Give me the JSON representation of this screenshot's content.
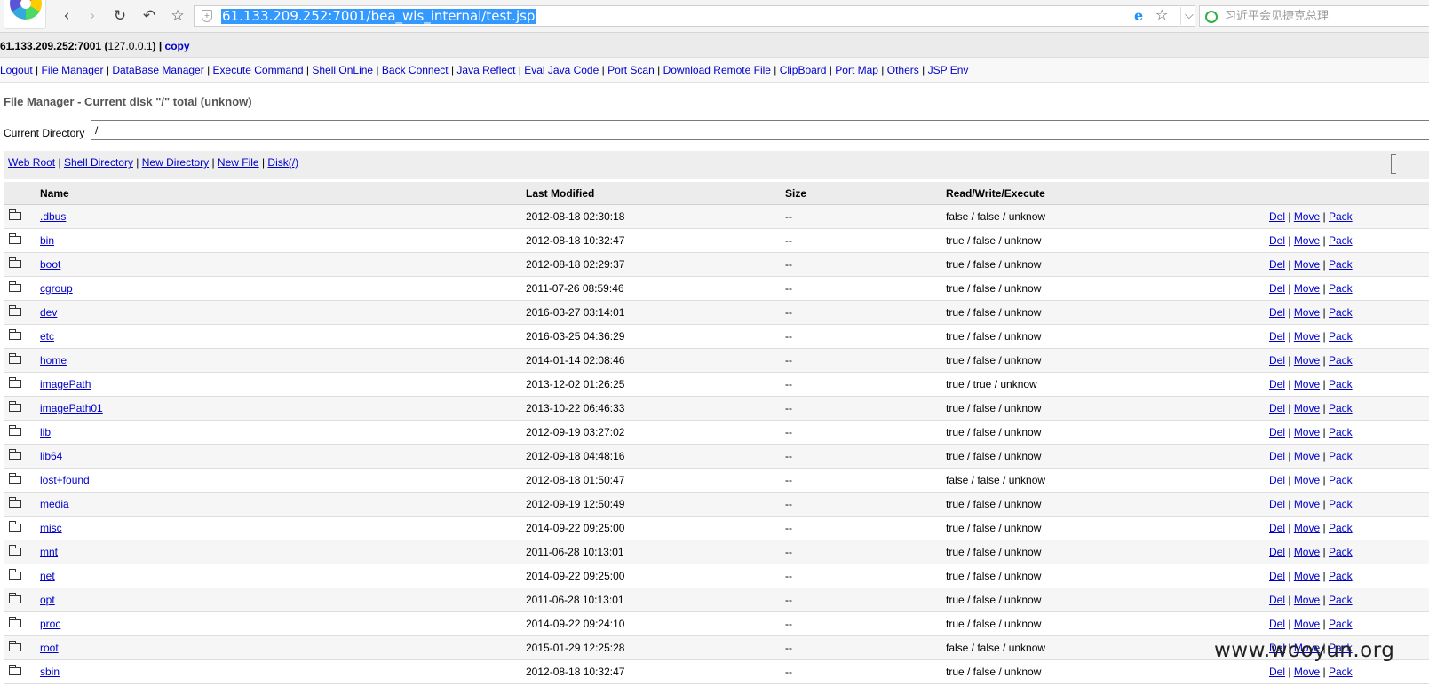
{
  "browser": {
    "url": "61.133.209.252:7001/bea_wls_internal/test.jsp",
    "search_placeholder": "习近平会见捷克总理",
    "back_icon": "‹",
    "forward_icon": "›",
    "reload_icon": "↻",
    "undo_icon": "↶",
    "star_icon": "☆",
    "ie_icon": "e",
    "chevron_icon": "⌵"
  },
  "host": {
    "address": "61.133.209.252:7001",
    "local_ip": "127.0.0.1",
    "copy_label": "copy"
  },
  "nav": {
    "items": [
      "Logout",
      "File Manager",
      "DataBase Manager",
      "Execute Command",
      "Shell OnLine",
      "Back Connect",
      "Java Reflect",
      "Eval Java Code",
      "Port Scan",
      "Download Remote File",
      "ClipBoard",
      "Port Map",
      "Others",
      "JSP Env"
    ]
  },
  "page": {
    "title": "File Manager - Current disk \"/\" total (unknow)",
    "current_dir_label": "Current Directory",
    "current_dir_value": "/"
  },
  "quick_links": [
    "Web Root",
    "Shell Directory",
    "New Directory",
    "New File",
    "Disk(/)"
  ],
  "table": {
    "headers": [
      "Name",
      "Last Modified",
      "Size",
      "Read/Write/Execute"
    ],
    "actions": [
      "Del",
      "Move",
      "Pack"
    ],
    "rows": [
      {
        "name": ".dbus",
        "modified": "2012-08-18 02:30:18",
        "size": "--",
        "perm": "false / false / unknow"
      },
      {
        "name": "bin",
        "modified": "2012-08-18 10:32:47",
        "size": "--",
        "perm": "true / false / unknow"
      },
      {
        "name": "boot",
        "modified": "2012-08-18 02:29:37",
        "size": "--",
        "perm": "true / false / unknow"
      },
      {
        "name": "cgroup",
        "modified": "2011-07-26 08:59:46",
        "size": "--",
        "perm": "true / false / unknow"
      },
      {
        "name": "dev",
        "modified": "2016-03-27 03:14:01",
        "size": "--",
        "perm": "true / false / unknow"
      },
      {
        "name": "etc",
        "modified": "2016-03-25 04:36:29",
        "size": "--",
        "perm": "true / false / unknow"
      },
      {
        "name": "home",
        "modified": "2014-01-14 02:08:46",
        "size": "--",
        "perm": "true / false / unknow"
      },
      {
        "name": "imagePath",
        "modified": "2013-12-02 01:26:25",
        "size": "--",
        "perm": "true / true / unknow"
      },
      {
        "name": "imagePath01",
        "modified": "2013-10-22 06:46:33",
        "size": "--",
        "perm": "true / false / unknow"
      },
      {
        "name": "lib",
        "modified": "2012-09-19 03:27:02",
        "size": "--",
        "perm": "true / false / unknow"
      },
      {
        "name": "lib64",
        "modified": "2012-09-18 04:48:16",
        "size": "--",
        "perm": "true / false / unknow"
      },
      {
        "name": "lost+found",
        "modified": "2012-08-18 01:50:47",
        "size": "--",
        "perm": "false / false / unknow"
      },
      {
        "name": "media",
        "modified": "2012-09-19 12:50:49",
        "size": "--",
        "perm": "true / false / unknow"
      },
      {
        "name": "misc",
        "modified": "2014-09-22 09:25:00",
        "size": "--",
        "perm": "true / false / unknow"
      },
      {
        "name": "mnt",
        "modified": "2011-06-28 10:13:01",
        "size": "--",
        "perm": "true / false / unknow"
      },
      {
        "name": "net",
        "modified": "2014-09-22 09:25:00",
        "size": "--",
        "perm": "true / false / unknow"
      },
      {
        "name": "opt",
        "modified": "2011-06-28 10:13:01",
        "size": "--",
        "perm": "true / false / unknow"
      },
      {
        "name": "proc",
        "modified": "2014-09-22 09:24:10",
        "size": "--",
        "perm": "true / false / unknow"
      },
      {
        "name": "root",
        "modified": "2015-01-29 12:25:28",
        "size": "--",
        "perm": "false / false / unknow"
      },
      {
        "name": "sbin",
        "modified": "2012-08-18 10:32:47",
        "size": "--",
        "perm": "true / false / unknow"
      }
    ]
  },
  "watermark": "www.wooyun.org"
}
